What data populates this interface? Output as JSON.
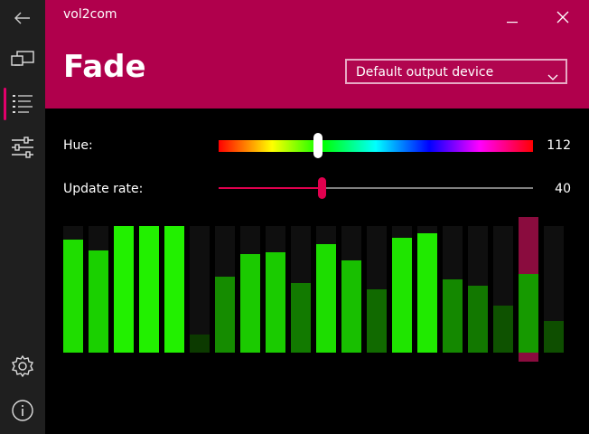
{
  "app": {
    "title": "vol2com"
  },
  "nav": {
    "items": [
      {
        "name": "back",
        "icon": "back-arrow-icon"
      },
      {
        "name": "devices",
        "icon": "cast-icon"
      },
      {
        "name": "modes",
        "icon": "list-icon",
        "active": true
      },
      {
        "name": "adjust",
        "icon": "sliders-icon"
      },
      {
        "name": "settings",
        "icon": "gear-icon"
      },
      {
        "name": "about",
        "icon": "info-icon"
      }
    ]
  },
  "header": {
    "page_title": "Fade",
    "device_select": {
      "selected": "Default output device"
    }
  },
  "controls": {
    "hue": {
      "label": "Hue:",
      "value": "112"
    },
    "update_rate": {
      "label": "Update rate:",
      "value": "40"
    }
  },
  "visualizer": {
    "max": 100,
    "bars": [
      {
        "level": 89,
        "color": "#1fdd00"
      },
      {
        "level": 81,
        "color": "#1ad000"
      },
      {
        "level": 100,
        "color": "#22f000"
      },
      {
        "level": 100,
        "color": "#22f000"
      },
      {
        "level": 100,
        "color": "#22f000"
      },
      {
        "level": 14,
        "color": "#0c3a00"
      },
      {
        "level": 60,
        "color": "#158c00"
      },
      {
        "level": 78,
        "color": "#1bca00"
      },
      {
        "level": 79,
        "color": "#1acb00"
      },
      {
        "level": 55,
        "color": "#127a00"
      },
      {
        "level": 86,
        "color": "#1ddd00"
      },
      {
        "level": 73,
        "color": "#18bf00"
      },
      {
        "level": 50,
        "color": "#116a00"
      },
      {
        "level": 91,
        "color": "#1fe500"
      },
      {
        "level": 94,
        "color": "#20ea00"
      },
      {
        "level": 58,
        "color": "#148800"
      },
      {
        "level": 53,
        "color": "#127800"
      },
      {
        "level": 37,
        "color": "#0e5200"
      },
      {
        "level": 100,
        "color": "#169a00",
        "over": true,
        "raw": 62
      },
      {
        "level": 25,
        "color": "#0e4e00"
      }
    ]
  },
  "colors": {
    "accent": "#b0004c",
    "nav_bg": "#1f1f1f",
    "slider_accent": "#e0004e"
  }
}
